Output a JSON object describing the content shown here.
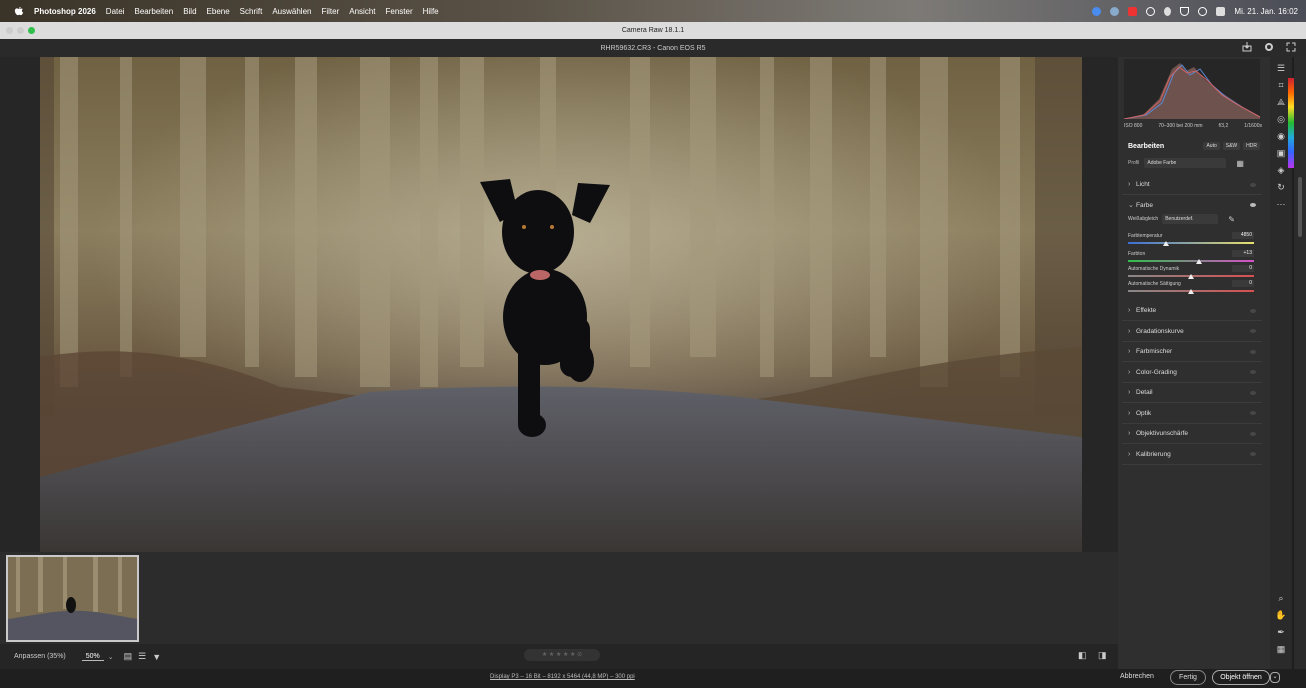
{
  "menubar": {
    "app": "Photoshop 2026",
    "items": [
      "Datei",
      "Bearbeiten",
      "Bild",
      "Ebene",
      "Schrift",
      "Auswählen",
      "Filter",
      "Ansicht",
      "Fenster",
      "Hilfe"
    ],
    "clock": "Mi. 21. Jan. 16:02"
  },
  "window": {
    "title": "Camera Raw 18.1.1",
    "file": "RHR59632.CR3 - Canon EOS R5"
  },
  "exif": {
    "iso": "ISO 800",
    "lens": "70–300 bei 200 mm",
    "aperture": "f/3,2",
    "shutter": "1/1600s"
  },
  "edit": {
    "title": "Bearbeiten",
    "buttons": [
      "Auto",
      "S&W",
      "HDR"
    ],
    "profile_label": "Profil",
    "profile_value": "Adobe Farbe"
  },
  "sections": {
    "licht": "Licht",
    "farbe": "Farbe",
    "after": [
      "Effekte",
      "Gradationskurve",
      "Farbmischer",
      "Color-Grading",
      "Detail",
      "Optik",
      "Objektivunschärfe",
      "Kalibrierung"
    ]
  },
  "farbe": {
    "wb_label": "Weißabgleich",
    "wb_value": "Benutzerdef.",
    "sliders": [
      {
        "label": "Farbtemperatur",
        "value": "4850",
        "pos": 0.3
      },
      {
        "label": "Farbton",
        "value": "+13",
        "pos": 0.56
      },
      {
        "label": "Automatische Dynamik",
        "value": "0",
        "pos": 0.5
      },
      {
        "label": "Automatische Sättigung",
        "value": "0",
        "pos": 0.5
      }
    ]
  },
  "bottom": {
    "fit": "Anpassen (35%)",
    "zoom": "50%",
    "rating_stars": 5
  },
  "status": {
    "info": "Display P3 – 16 Bit – 8192 x 5464 (44,8 MP) – 300 ppi",
    "cancel": "Abbrechen",
    "done": "Fertig",
    "open": "Objekt öffnen"
  },
  "colors": {
    "accent": "#2a74d5",
    "panel": "#2f2f2f",
    "highlight": "#ffffff"
  }
}
